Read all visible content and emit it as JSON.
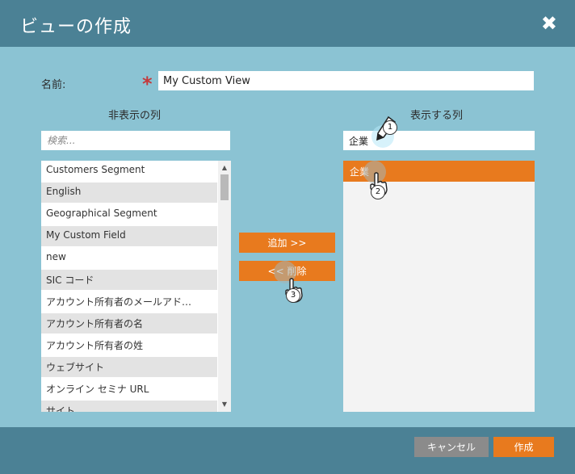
{
  "dialog": {
    "title": "ビューの作成",
    "close_label": "✖"
  },
  "name_label": "名前:",
  "required_mark": "*",
  "name_value": "My Custom View",
  "hidden_columns_label": "非表示の列",
  "shown_columns_label": "表示する列",
  "search_placeholder": "検索...",
  "shown_search_value": "企業",
  "hidden_items": [
    "Customers Segment",
    "English",
    "Geographical Segment",
    "My Custom Field",
    "new",
    "SIC コード",
    "アカウント所有者のメールアド…",
    "アカウント所有者の名",
    "アカウント所有者の姓",
    "ウェブサイト",
    "オンライン セミナ URL",
    "サイト"
  ],
  "shown_items": [
    "企業"
  ],
  "add_button": "追加 >>",
  "remove_button": "<< 削除",
  "cancel_button": "キャンセル",
  "create_button": "作成",
  "step_markers": [
    "1",
    "2",
    "3"
  ],
  "colors": {
    "header": "#4b8195",
    "body": "#8bc3d3",
    "accent": "#e87a1e",
    "cancel": "#8b8b8b"
  }
}
